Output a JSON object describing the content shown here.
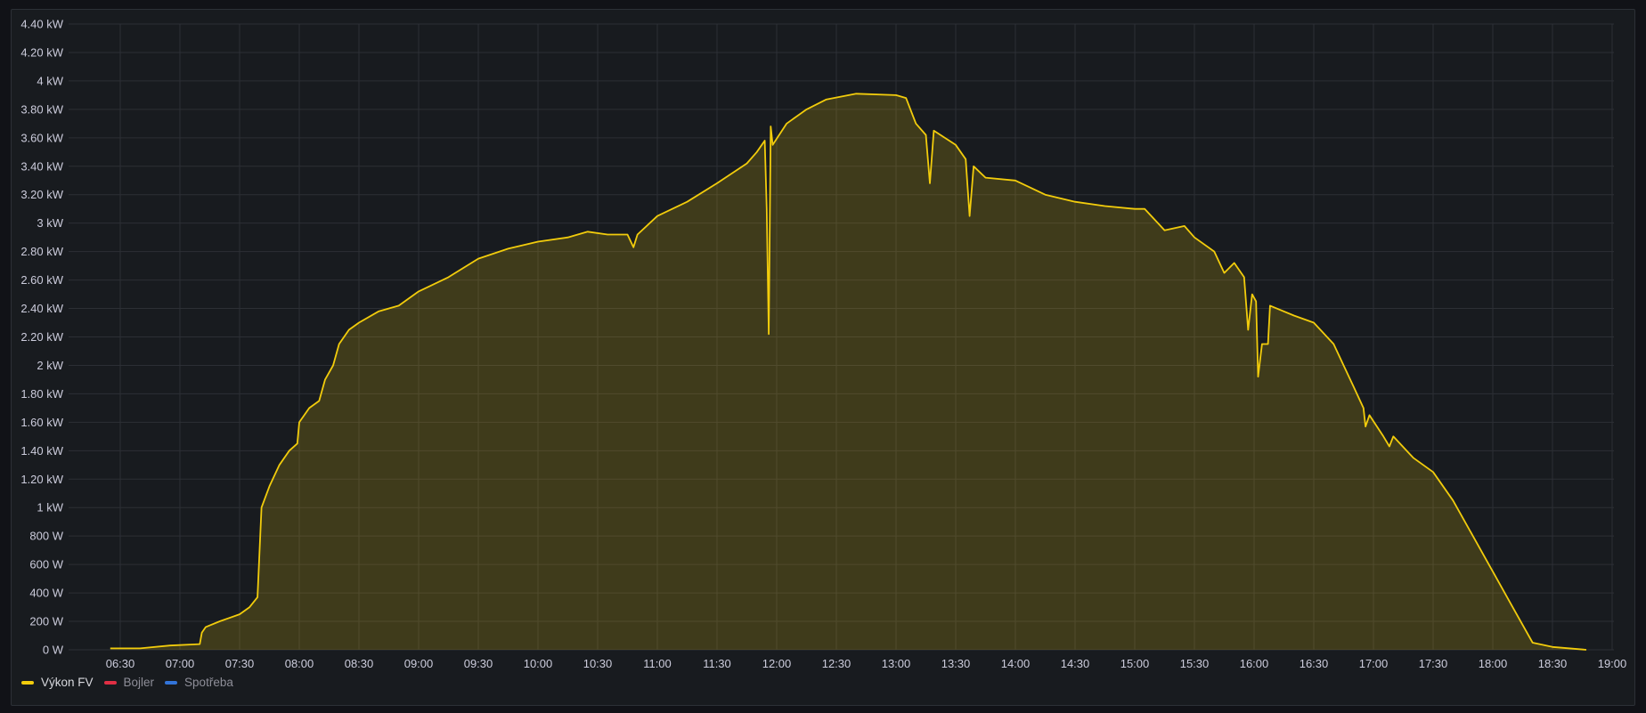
{
  "chart_data": {
    "type": "area",
    "title": "",
    "xlabel": "",
    "ylabel": "",
    "unit": "kW",
    "ylim": [
      0,
      4.4
    ],
    "xlim": [
      "06:30",
      "19:00"
    ],
    "grid": true,
    "legend_position": "bottom-left",
    "y_ticks": [
      {
        "v": 0,
        "label": "0 W"
      },
      {
        "v": 0.2,
        "label": "200 W"
      },
      {
        "v": 0.4,
        "label": "400 W"
      },
      {
        "v": 0.6,
        "label": "600 W"
      },
      {
        "v": 0.8,
        "label": "800 W"
      },
      {
        "v": 1.0,
        "label": "1 kW"
      },
      {
        "v": 1.2,
        "label": "1.20 kW"
      },
      {
        "v": 1.4,
        "label": "1.40 kW"
      },
      {
        "v": 1.6,
        "label": "1.60 kW"
      },
      {
        "v": 1.8,
        "label": "1.80 kW"
      },
      {
        "v": 2.0,
        "label": "2 kW"
      },
      {
        "v": 2.2,
        "label": "2.20 kW"
      },
      {
        "v": 2.4,
        "label": "2.40 kW"
      },
      {
        "v": 2.6,
        "label": "2.60 kW"
      },
      {
        "v": 2.8,
        "label": "2.80 kW"
      },
      {
        "v": 3.0,
        "label": "3 kW"
      },
      {
        "v": 3.2,
        "label": "3.20 kW"
      },
      {
        "v": 3.4,
        "label": "3.40 kW"
      },
      {
        "v": 3.6,
        "label": "3.60 kW"
      },
      {
        "v": 3.8,
        "label": "3.80 kW"
      },
      {
        "v": 4.0,
        "label": "4 kW"
      },
      {
        "v": 4.2,
        "label": "4.20 kW"
      },
      {
        "v": 4.4,
        "label": "4.40 kW"
      }
    ],
    "x_ticks": [
      "06:30",
      "07:00",
      "07:30",
      "08:00",
      "08:30",
      "09:00",
      "09:30",
      "10:00",
      "10:30",
      "11:00",
      "11:30",
      "12:00",
      "12:30",
      "13:00",
      "13:30",
      "14:00",
      "14:30",
      "15:00",
      "15:30",
      "16:00",
      "16:30",
      "17:00",
      "17:30",
      "18:00",
      "18:30",
      "19:00"
    ],
    "series": [
      {
        "name": "Výkon FV",
        "color": "#F2CC0C",
        "points": [
          [
            "06:25",
            0.01
          ],
          [
            "06:40",
            0.01
          ],
          [
            "06:55",
            0.03
          ],
          [
            "07:10",
            0.04
          ],
          [
            "07:11",
            0.12
          ],
          [
            "07:13",
            0.16
          ],
          [
            "07:20",
            0.2
          ],
          [
            "07:30",
            0.25
          ],
          [
            "07:35",
            0.3
          ],
          [
            "07:39",
            0.37
          ],
          [
            "07:41",
            1.0
          ],
          [
            "07:45",
            1.15
          ],
          [
            "07:50",
            1.3
          ],
          [
            "07:55",
            1.4
          ],
          [
            "07:59",
            1.45
          ],
          [
            "08:00",
            1.6
          ],
          [
            "08:05",
            1.7
          ],
          [
            "08:10",
            1.75
          ],
          [
            "08:13",
            1.9
          ],
          [
            "08:17",
            2.0
          ],
          [
            "08:20",
            2.15
          ],
          [
            "08:25",
            2.25
          ],
          [
            "08:30",
            2.3
          ],
          [
            "08:40",
            2.38
          ],
          [
            "08:50",
            2.42
          ],
          [
            "09:00",
            2.52
          ],
          [
            "09:15",
            2.62
          ],
          [
            "09:30",
            2.75
          ],
          [
            "09:45",
            2.82
          ],
          [
            "10:00",
            2.87
          ],
          [
            "10:15",
            2.9
          ],
          [
            "10:25",
            2.94
          ],
          [
            "10:35",
            2.92
          ],
          [
            "10:45",
            2.92
          ],
          [
            "10:48",
            2.83
          ],
          [
            "10:50",
            2.92
          ],
          [
            "11:00",
            3.05
          ],
          [
            "11:15",
            3.15
          ],
          [
            "11:30",
            3.28
          ],
          [
            "11:45",
            3.42
          ],
          [
            "11:50",
            3.5
          ],
          [
            "11:54",
            3.58
          ],
          [
            "11:55",
            3.1
          ],
          [
            "11:56",
            2.22
          ],
          [
            "11:57",
            3.68
          ],
          [
            "11:58",
            3.55
          ],
          [
            "12:05",
            3.7
          ],
          [
            "12:15",
            3.8
          ],
          [
            "12:25",
            3.87
          ],
          [
            "12:40",
            3.91
          ],
          [
            "13:00",
            3.9
          ],
          [
            "13:05",
            3.88
          ],
          [
            "13:10",
            3.7
          ],
          [
            "13:15",
            3.62
          ],
          [
            "13:17",
            3.28
          ],
          [
            "13:19",
            3.65
          ],
          [
            "13:30",
            3.55
          ],
          [
            "13:35",
            3.45
          ],
          [
            "13:37",
            3.05
          ],
          [
            "13:39",
            3.4
          ],
          [
            "13:45",
            3.32
          ],
          [
            "14:00",
            3.3
          ],
          [
            "14:15",
            3.2
          ],
          [
            "14:30",
            3.15
          ],
          [
            "14:45",
            3.12
          ],
          [
            "15:00",
            3.1
          ],
          [
            "15:05",
            3.1
          ],
          [
            "15:15",
            2.95
          ],
          [
            "15:25",
            2.98
          ],
          [
            "15:30",
            2.9
          ],
          [
            "15:40",
            2.8
          ],
          [
            "15:45",
            2.65
          ],
          [
            "15:50",
            2.72
          ],
          [
            "15:55",
            2.62
          ],
          [
            "15:57",
            2.25
          ],
          [
            "15:59",
            2.5
          ],
          [
            "16:01",
            2.45
          ],
          [
            "16:02",
            1.92
          ],
          [
            "16:04",
            2.15
          ],
          [
            "16:07",
            2.15
          ],
          [
            "16:08",
            2.42
          ],
          [
            "16:20",
            2.35
          ],
          [
            "16:30",
            2.3
          ],
          [
            "16:40",
            2.15
          ],
          [
            "16:45",
            2.0
          ],
          [
            "16:50",
            1.85
          ],
          [
            "16:55",
            1.7
          ],
          [
            "16:56",
            1.57
          ],
          [
            "16:58",
            1.65
          ],
          [
            "17:05",
            1.5
          ],
          [
            "17:08",
            1.43
          ],
          [
            "17:10",
            1.5
          ],
          [
            "17:20",
            1.35
          ],
          [
            "17:30",
            1.25
          ],
          [
            "17:40",
            1.05
          ],
          [
            "17:50",
            0.8
          ],
          [
            "18:00",
            0.55
          ],
          [
            "18:10",
            0.3
          ],
          [
            "18:20",
            0.05
          ],
          [
            "18:30",
            0.02
          ],
          [
            "18:47",
            0.0
          ]
        ]
      },
      {
        "name": "Bojler",
        "color": "#E02F44",
        "points": []
      },
      {
        "name": "Spotřeba",
        "color": "#3274D9",
        "points": []
      }
    ]
  }
}
